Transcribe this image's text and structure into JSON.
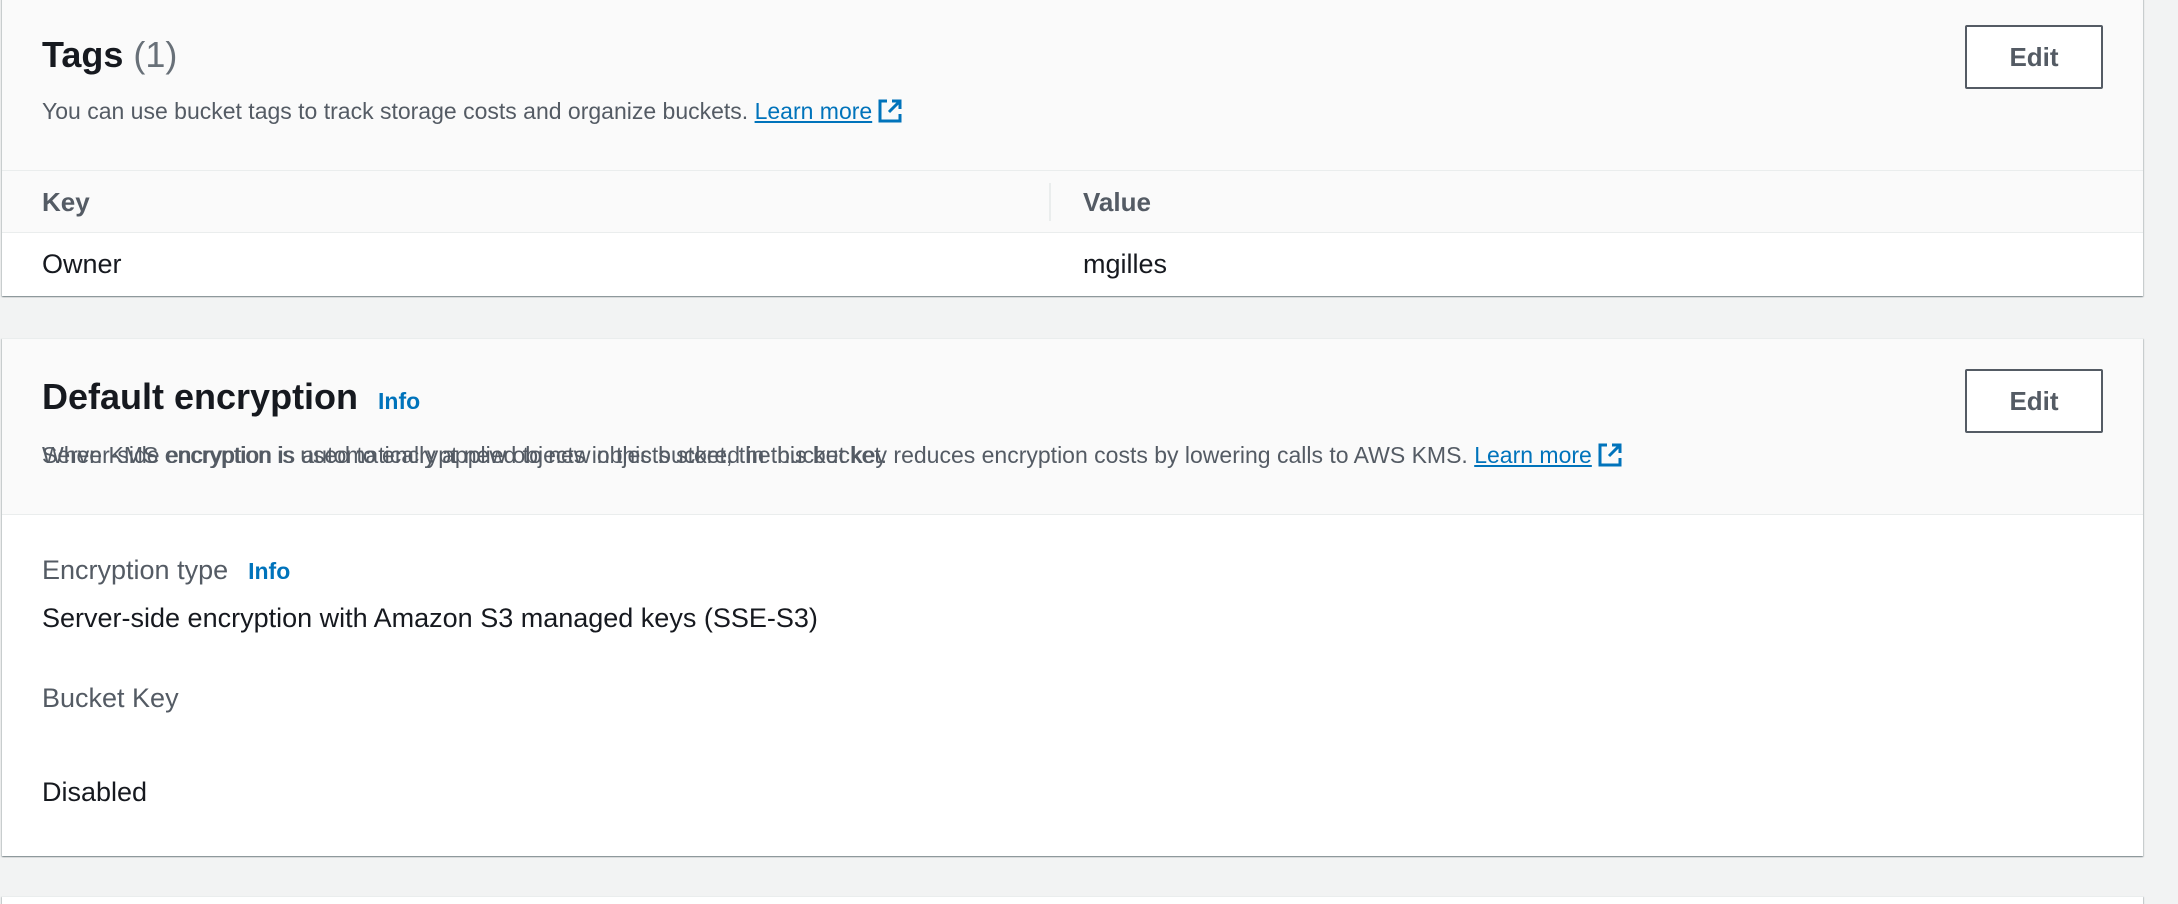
{
  "tags": {
    "title": "Tags",
    "count": "(1)",
    "description": "You can use bucket tags to track storage costs and organize buckets.",
    "learn_more": "Learn more",
    "edit_label": "Edit",
    "columns": {
      "key": "Key",
      "value": "Value"
    },
    "rows": [
      {
        "key": "Owner",
        "value": "mgilles"
      }
    ]
  },
  "encryption": {
    "title": "Default encryption",
    "info": "Info",
    "description": "Server-side encryption is automatically applied to new objects stored in this bucket.",
    "edit_label": "Edit",
    "type_label": "Encryption type",
    "type_info": "Info",
    "type_value": "Server-side encryption with Amazon S3 managed keys (SSE-S3)",
    "bucket_key_label": "Bucket Key",
    "bucket_key_description": "When KMS encryption is used to encrypt new objects in this bucket, the bucket key reduces encryption costs by lowering calls to AWS KMS.",
    "bucket_key_learn_more": "Learn more",
    "bucket_key_value": "Disabled"
  },
  "icons": {
    "external_link": "external-link-icon"
  },
  "colors": {
    "link": "#0073bb",
    "background": "#f2f3f3",
    "text": "#16191f",
    "secondary_text": "#545b64"
  }
}
